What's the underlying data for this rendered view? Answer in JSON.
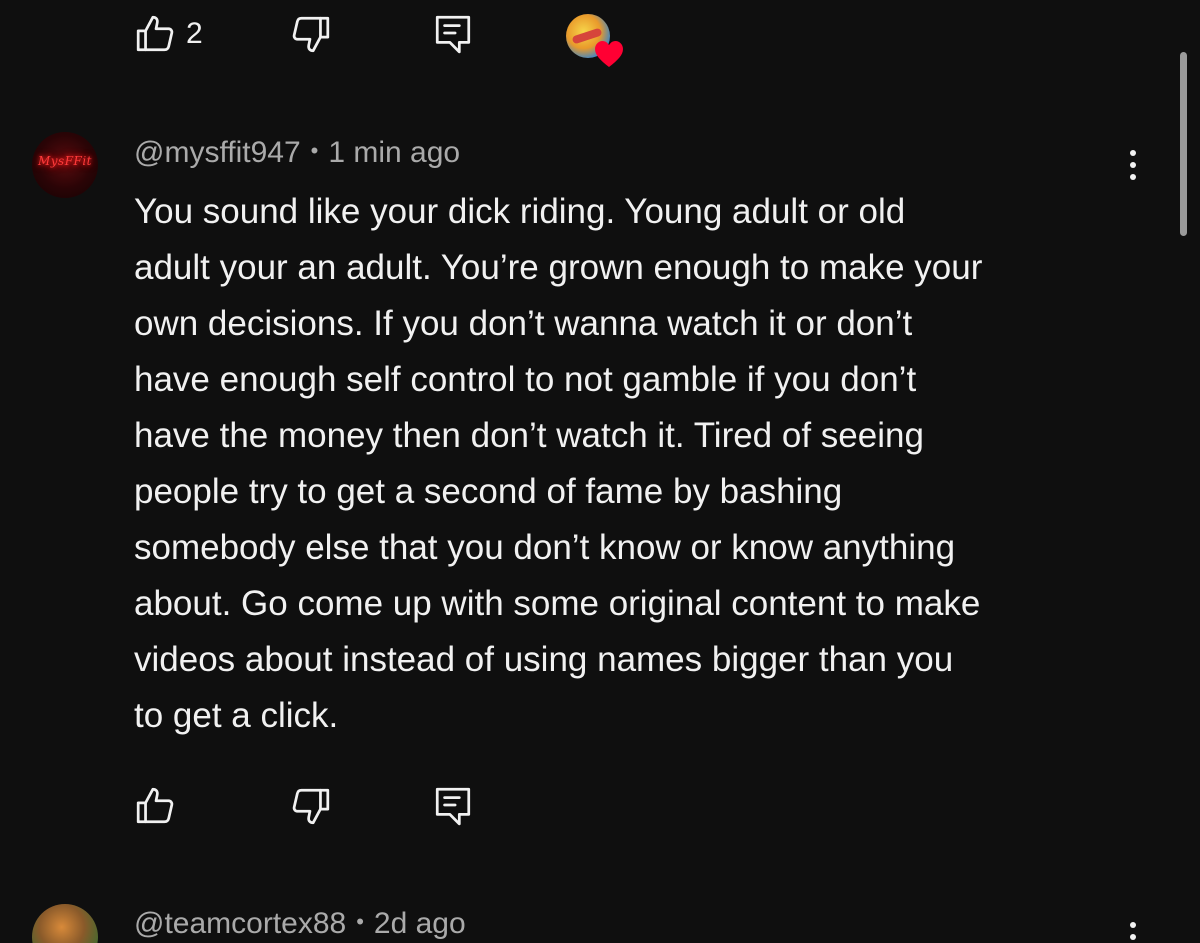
{
  "top_actions": {
    "like_count": "2"
  },
  "comments": [
    {
      "handle": "@mysffit947",
      "separator": "•",
      "time": "1 min ago",
      "avatar_text": "MysFFit",
      "lines": [
        "You sound like your dick riding. Young adult or old",
        "adult your an adult. You’re grown enough to make your",
        "own decisions. If you don’t wanna watch it or don’t",
        "have enough self control to not gamble if you don’t",
        "have the money then don’t watch it. Tired of seeing",
        "people try to get a second of fame by bashing",
        "somebody else that you don’t know or know anything",
        "about. Go come up with some original content to make",
        "videos about instead of using names bigger than you",
        "to get a click."
      ]
    },
    {
      "handle": "@teamcortex88",
      "separator": "•",
      "time": "2d ago"
    }
  ],
  "icons": {
    "like": "thumbs-up-icon",
    "dislike": "thumbs-down-icon",
    "reply": "reply-icon",
    "more": "more-vert-icon",
    "creator_heart": "heart-icon"
  },
  "colors": {
    "background": "#0f0f0f",
    "text_primary": "#f1f1f1",
    "text_secondary": "#aaaaaa",
    "heart": "#ff0033"
  }
}
